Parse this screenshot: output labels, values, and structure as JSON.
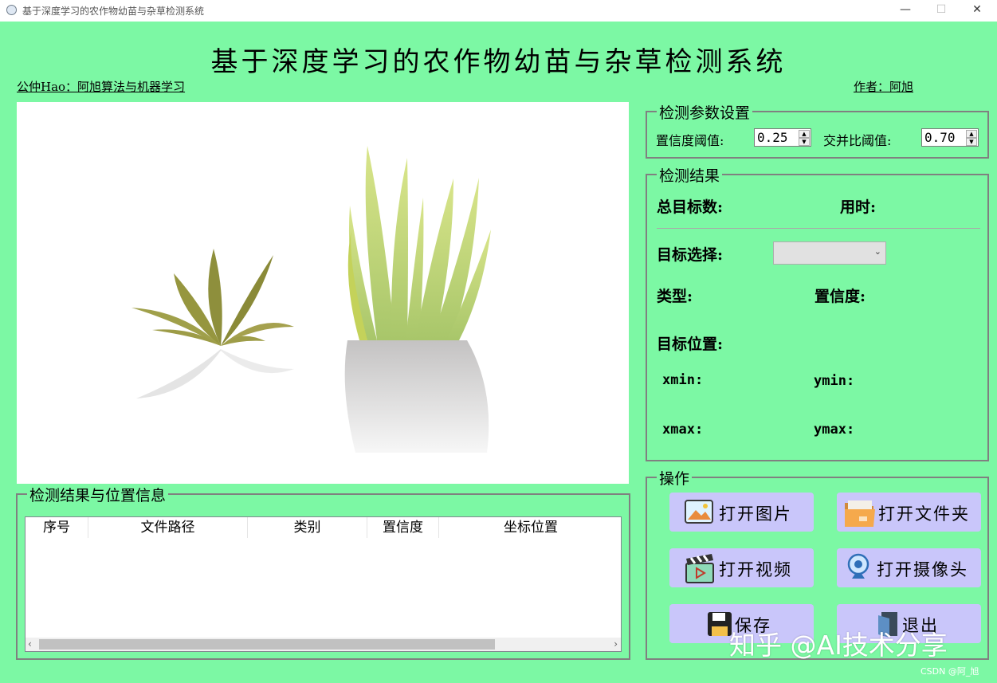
{
  "window": {
    "title": "基于深度学习的农作物幼苗与杂草检测系统",
    "minimize": "—",
    "maximize": "☐",
    "close": "✕"
  },
  "header": {
    "title": "基于深度学习的农作物幼苗与杂草检测系统",
    "left_link": "公仲Hao：阿旭算法与机器学习",
    "right_link": "作者：阿旭"
  },
  "params": {
    "title": "检测参数设置",
    "conf_label": "置信度阈值:",
    "conf_value": "0.25",
    "iou_label": "交并比阈值:",
    "iou_value": "0.70"
  },
  "result": {
    "title": "检测结果",
    "total_label": "总目标数:",
    "time_label": "用时:",
    "target_select_label": "目标选择:",
    "target_select_value": "",
    "type_label": "类型:",
    "conf_label": "置信度:",
    "pos_label": "目标位置:",
    "xmin_label": "xmin:",
    "ymin_label": "ymin:",
    "xmax_label": "xmax:",
    "ymax_label": "ymax:"
  },
  "table": {
    "title": "检测结果与位置信息",
    "columns": [
      "序号",
      "文件路径",
      "类别",
      "置信度",
      "坐标位置"
    ]
  },
  "ops": {
    "title": "操作",
    "open_image": "打开图片",
    "open_folder": "打开文件夹",
    "open_video": "打开视频",
    "open_camera": "打开摄像头",
    "save": "保存",
    "exit": "退出"
  },
  "watermark": "知乎 @AI技术分享",
  "csdn": "CSDN @阿_旭"
}
